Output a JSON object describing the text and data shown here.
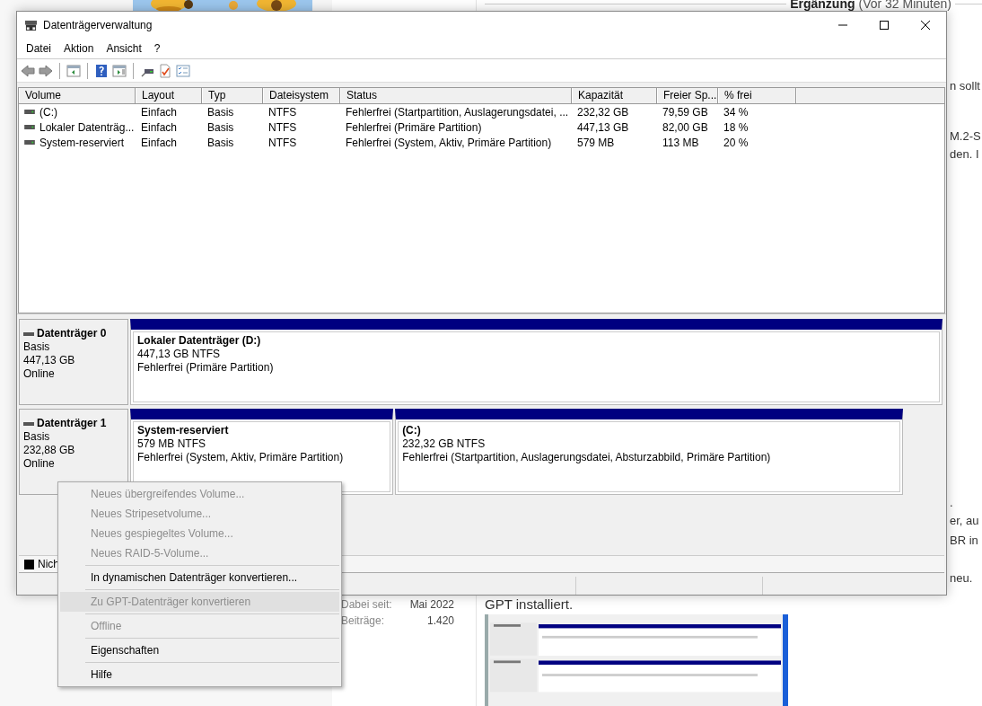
{
  "background_page": {
    "note_header": {
      "title": "Ergänzung",
      "time": "(Vor 32 Minuten)"
    },
    "text_fragments": [
      {
        "text": "n sollt",
        "kind": "right"
      },
      {
        "text": "M.2-S",
        "kind": "right"
      },
      {
        "text": "den. I",
        "kind": "right"
      },
      {
        "text": ".",
        "kind": "right"
      },
      {
        "text": "er, au",
        "kind": "right"
      },
      {
        "text": "BR in",
        "kind": "right"
      },
      {
        "text": "neu.",
        "kind": "right"
      }
    ],
    "user_info": [
      {
        "label": "Dabei seit:",
        "value": "Mai 2022"
      },
      {
        "label": "Beiträge:",
        "value": "1.420"
      }
    ],
    "post_text": "GPT installiert."
  },
  "window": {
    "title": "Datenträgerverwaltung",
    "menu": [
      "Datei",
      "Aktion",
      "Ansicht",
      "?"
    ],
    "volume_table": {
      "columns": [
        "Volume",
        "Layout",
        "Typ",
        "Dateisystem",
        "Status",
        "Kapazität",
        "Freier Sp...",
        "% frei"
      ],
      "rows": [
        [
          "(C:)",
          "Einfach",
          "Basis",
          "NTFS",
          "Fehlerfrei (Startpartition, Auslagerungsdatei, ...",
          "232,32 GB",
          "79,59 GB",
          "34 %"
        ],
        [
          "Lokaler Datenträg...",
          "Einfach",
          "Basis",
          "NTFS",
          "Fehlerfrei (Primäre Partition)",
          "447,13 GB",
          "82,00 GB",
          "18 %"
        ],
        [
          "System-reserviert",
          "Einfach",
          "Basis",
          "NTFS",
          "Fehlerfrei (System, Aktiv, Primäre Partition)",
          "579 MB",
          "113 MB",
          "20 %"
        ]
      ]
    },
    "disks": [
      {
        "name": "Datenträger 0",
        "type": "Basis",
        "size": "447,13 GB",
        "status": "Online",
        "partitions": [
          {
            "name": "Lokaler Datenträger  (D:)",
            "size": "447,13 GB NTFS",
            "status": "Fehlerfrei (Primäre Partition)"
          }
        ]
      },
      {
        "name": "Datenträger 1",
        "type": "Basis",
        "size": "232,88 GB",
        "status": "Online",
        "partitions": [
          {
            "name": "System-reserviert",
            "size": "579 MB NTFS",
            "status": "Fehlerfrei (System, Aktiv, Primäre Partition)"
          },
          {
            "name": "(C:)",
            "size": "232,32 GB NTFS",
            "status": "Fehlerfrei (Startpartition, Auslagerungsdatei, Absturzabbild, Primäre Partition)"
          }
        ]
      }
    ],
    "legend": [
      {
        "label": "Nich",
        "color": "#000000"
      }
    ]
  },
  "context_menu": {
    "items": [
      {
        "kind": "item",
        "label": "Neues übergreifendes Volume...",
        "disabled": true,
        "highlighted": false
      },
      {
        "kind": "item",
        "label": "Neues Stripesetvolume...",
        "disabled": true,
        "highlighted": false
      },
      {
        "kind": "item",
        "label": "Neues gespiegeltes Volume...",
        "disabled": true,
        "highlighted": false
      },
      {
        "kind": "item",
        "label": "Neues RAID-5-Volume...",
        "disabled": true,
        "highlighted": false
      },
      {
        "kind": "separator"
      },
      {
        "kind": "item",
        "label": "In dynamischen Datenträger konvertieren...",
        "disabled": false,
        "highlighted": false
      },
      {
        "kind": "separator"
      },
      {
        "kind": "item",
        "label": "Zu GPT-Datenträger konvertieren",
        "disabled": true,
        "highlighted": true
      },
      {
        "kind": "separator"
      },
      {
        "kind": "item",
        "label": "Offline",
        "disabled": true,
        "highlighted": false
      },
      {
        "kind": "separator"
      },
      {
        "kind": "item",
        "label": "Eigenschaften",
        "disabled": false,
        "highlighted": false
      },
      {
        "kind": "separator"
      },
      {
        "kind": "item",
        "label": "Hilfe",
        "disabled": false,
        "highlighted": false
      }
    ]
  }
}
